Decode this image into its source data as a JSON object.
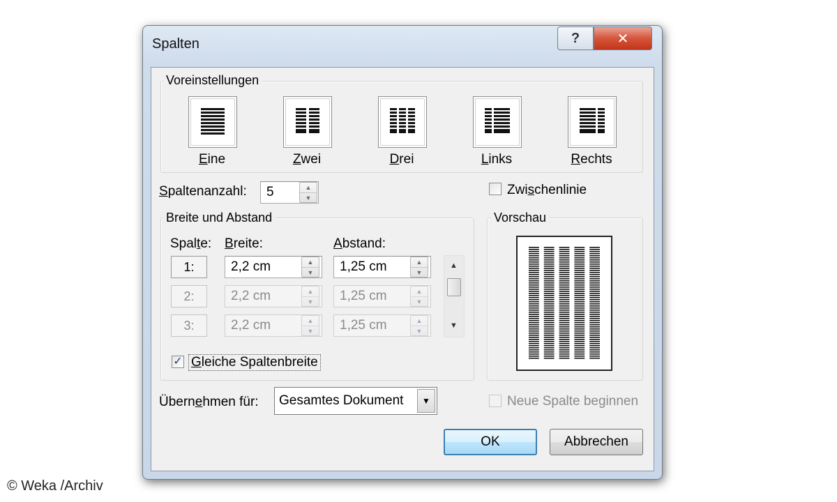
{
  "window": {
    "title": "Spalten",
    "help_label": "?",
    "close_label": "✕"
  },
  "presets": {
    "group_label": "Voreinstellungen",
    "items": [
      {
        "label": "Eine",
        "accel": "E",
        "rest": "ine"
      },
      {
        "label": "Zwei",
        "accel": "Z",
        "rest": "wei"
      },
      {
        "label": "Drei",
        "accel": "D",
        "rest": "rei"
      },
      {
        "label": "Links",
        "accel": "L",
        "rest": "inks"
      },
      {
        "label": "Rechts",
        "accel": "R",
        "rest": "echts"
      }
    ]
  },
  "column_count": {
    "accel": "S",
    "rest": "paltenanzahl:",
    "value": "5"
  },
  "line_between": {
    "pre": "Zwi",
    "accel": "s",
    "rest": "chenlinie",
    "checked": false
  },
  "width_spacing": {
    "group_label": "Breite und Abstand",
    "col_header_pre": "Spal",
    "col_header_accel": "t",
    "col_header_rest": "e:",
    "width_header_accel": "B",
    "width_header_rest": "reite:",
    "spacing_header_accel": "A",
    "spacing_header_rest": "bstand:",
    "rows": [
      {
        "num": "1:",
        "width": "2,2 cm",
        "spacing": "1,25 cm"
      },
      {
        "num": "2:",
        "width": "2,2 cm",
        "spacing": "1,25 cm"
      },
      {
        "num": "3:",
        "width": "2,2 cm",
        "spacing": "1,25 cm"
      }
    ],
    "equal_width": {
      "accel": "G",
      "rest": "leiche Spaltenbreite",
      "checked": true
    }
  },
  "preview": {
    "group_label": "Vorschau",
    "columns": 5
  },
  "apply_to": {
    "pre": "Übern",
    "accel": "e",
    "rest": "hmen für:",
    "value": "Gesamtes Dokument"
  },
  "new_column": {
    "label": "Neue Spalte beginnen",
    "checked": false
  },
  "buttons": {
    "ok": "OK",
    "cancel": "Abbrechen"
  },
  "watermark": "© Weka /Archiv"
}
